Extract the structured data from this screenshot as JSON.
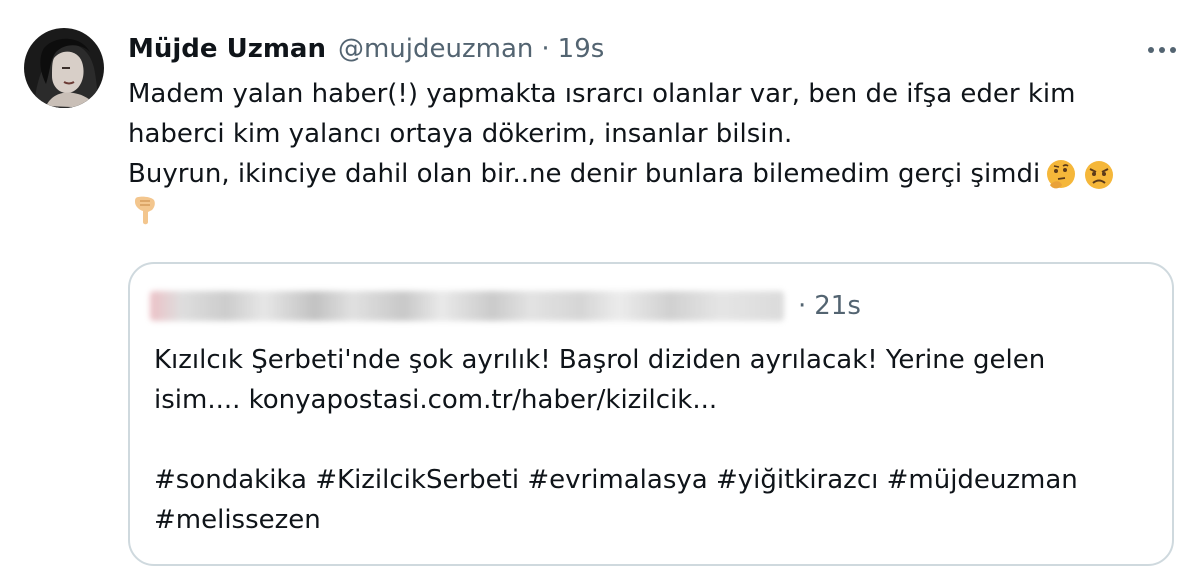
{
  "tweet": {
    "display_name": "Müjde Uzman",
    "handle": "@mujdeuzman",
    "separator": "·",
    "time": "19s",
    "more_icon": "more-horizontal-icon",
    "text_lines": [
      "Madem yalan haber(!) yapmakta ısrarcı olanlar var, ben de ifşa eder kim",
      "haberci kim yalancı ortaya dökerim, insanlar bilsin.",
      "Buyrun, ikinciye dahil olan bir..ne denir bunlara bilemedim gerçi şimdi"
    ],
    "emojis": [
      "thinking-face-emoji",
      "angry-face-emoji",
      "pointing-down-emoji"
    ]
  },
  "quoted_tweet": {
    "separator": "·",
    "time": "21s",
    "text_lines": [
      "Kızılcık Şerbeti'nde şok ayrılık! Başrol diziden ayrılacak! Yerine gelen",
      "isim.... konyapostasi.com.tr/haber/kizilcik...",
      "#sondakika #KizilcikSerbeti #evrimalasya #yiğitkirazcı #müjdeuzman",
      "#melissezen"
    ]
  },
  "colors": {
    "text": "#0f1419",
    "secondary": "#536471",
    "border": "#cfd9de",
    "background": "#ffffff"
  }
}
